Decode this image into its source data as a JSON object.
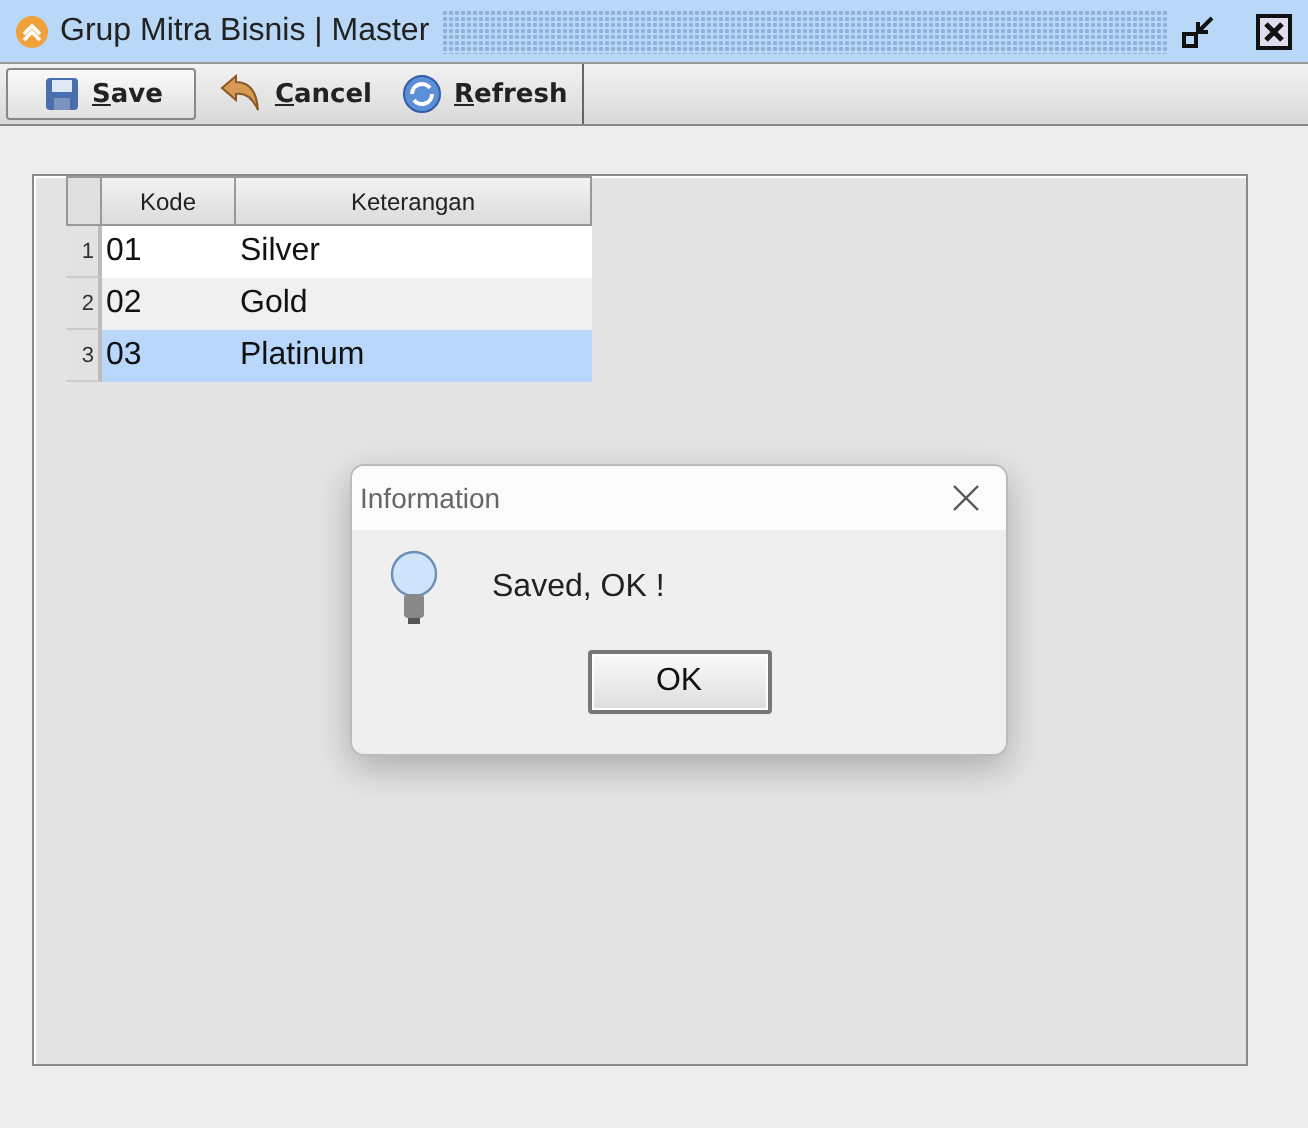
{
  "window": {
    "title": "Grup Mitra Bisnis | Master"
  },
  "toolbar": [
    {
      "kind": "save",
      "label": "Save",
      "pressed": true
    },
    {
      "kind": "cancel",
      "label": "Cancel",
      "pressed": false
    },
    {
      "kind": "refresh",
      "label": "Refresh",
      "pressed": false
    }
  ],
  "table": {
    "columns": [
      "Kode",
      "Keterangan"
    ],
    "rows": [
      {
        "number": "1",
        "cells": [
          "01",
          "Silver"
        ],
        "selected": false
      },
      {
        "number": "2",
        "cells": [
          "02",
          "Gold"
        ],
        "selected": false
      },
      {
        "number": "3",
        "cells": [
          "03",
          "Platinum"
        ],
        "selected": true
      }
    ]
  },
  "dialog": {
    "title": "Information",
    "message": "Saved, OK !",
    "button": "OK"
  }
}
